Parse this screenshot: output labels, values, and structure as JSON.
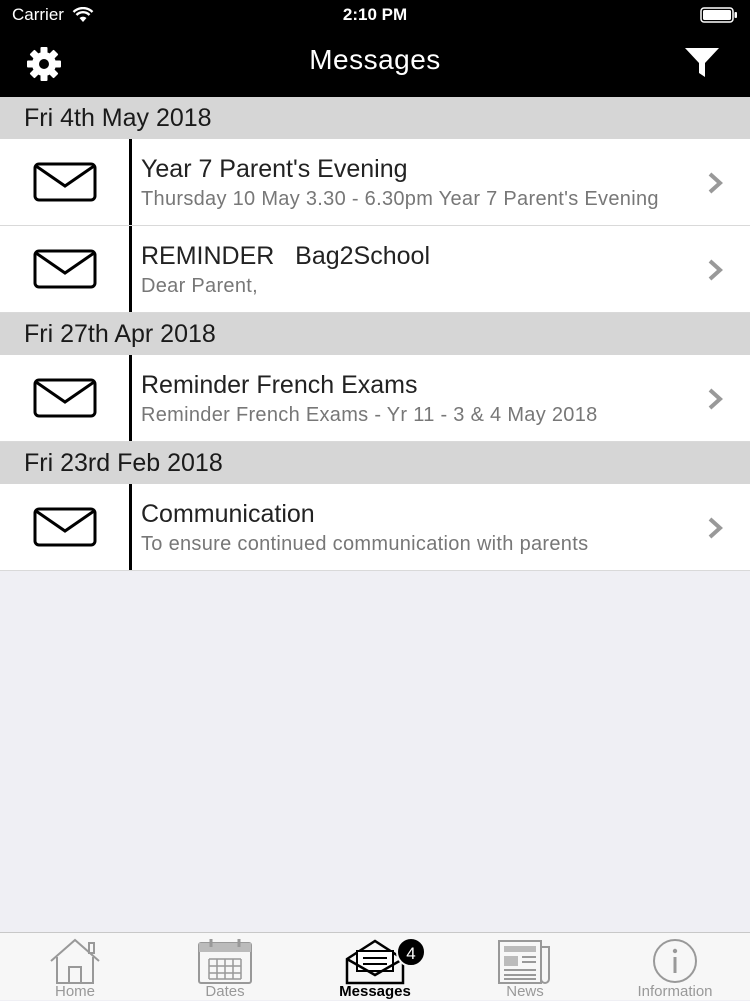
{
  "status_bar": {
    "carrier": "Carrier",
    "time": "2:10 PM"
  },
  "nav": {
    "title": "Messages",
    "left_icon": "gear-icon",
    "right_icon": "filter-icon"
  },
  "sections": [
    {
      "date": "Fri 4th May 2018",
      "messages": [
        {
          "title": "Year 7 Parent's Evening",
          "preview": "Thursday 10 May 3.30 - 6.30pm  Year 7 Parent's Evening"
        },
        {
          "title": "REMINDER   Bag2School",
          "preview": "Dear Parent,"
        }
      ]
    },
    {
      "date": "Fri 27th Apr 2018",
      "messages": [
        {
          "title": "Reminder French Exams",
          "preview": "Reminder French Exams - Yr 11 - 3 & 4  May 2018"
        }
      ]
    },
    {
      "date": "Fri 23rd Feb 2018",
      "messages": [
        {
          "title": "Communication",
          "preview": "To ensure continued communication with parents"
        }
      ]
    }
  ],
  "tabs": [
    {
      "label": "Home",
      "icon": "home-icon"
    },
    {
      "label": "Dates",
      "icon": "calendar-icon"
    },
    {
      "label": "Messages",
      "icon": "messages-icon",
      "active": true,
      "badge": "4"
    },
    {
      "label": "News",
      "icon": "newspaper-icon"
    },
    {
      "label": "Information",
      "icon": "info-icon"
    }
  ]
}
